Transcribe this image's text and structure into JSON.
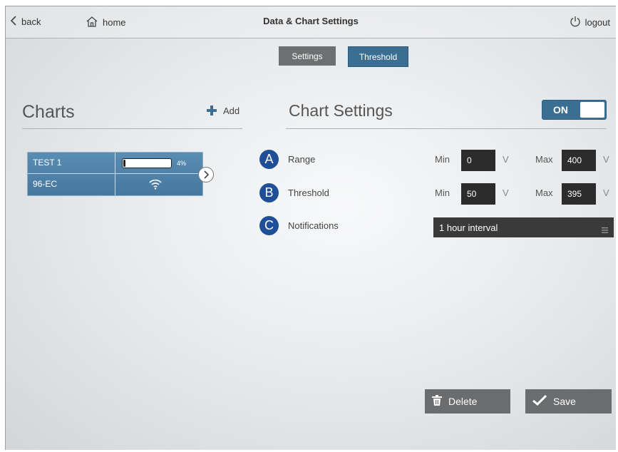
{
  "header": {
    "back_label": "back",
    "home_label": "home",
    "title": "Data & Chart Settings",
    "logout_label": "logout"
  },
  "tabs": [
    {
      "label": "Settings",
      "active": false
    },
    {
      "label": "Threshold",
      "active": true
    }
  ],
  "charts_panel": {
    "title": "Charts",
    "add_label": "Add",
    "cards": [
      {
        "name": "TEST 1",
        "id": "96-EC",
        "battery_percent_label": "4%",
        "battery_level": 0.04
      }
    ]
  },
  "chart_settings": {
    "title": "Chart Settings",
    "toggle_label": "ON",
    "rows": [
      {
        "badge": "A",
        "label": "Range",
        "min_label": "Min",
        "min_value": "0",
        "min_unit": "V",
        "max_label": "Max",
        "max_value": "400",
        "max_unit": "V"
      },
      {
        "badge": "B",
        "label": "Threshold",
        "min_label": "Min",
        "min_value": "50",
        "min_unit": "V",
        "max_label": "Max",
        "max_value": "395",
        "max_unit": "V"
      },
      {
        "badge": "C",
        "label": "Notifications",
        "select_value": "1 hour interval"
      }
    ],
    "delete_label": "Delete",
    "save_label": "Save"
  },
  "colors": {
    "accent": "#3a6e93",
    "badge": "#1e4f97",
    "dark_field": "#2c2c2c",
    "button_gray": "#6b6c6e"
  },
  "icons": [
    "chevron-left-icon",
    "home-icon",
    "power-icon",
    "plus-icon",
    "wifi-icon",
    "chevron-right-icon",
    "trash-icon",
    "check-icon",
    "menu-icon"
  ]
}
